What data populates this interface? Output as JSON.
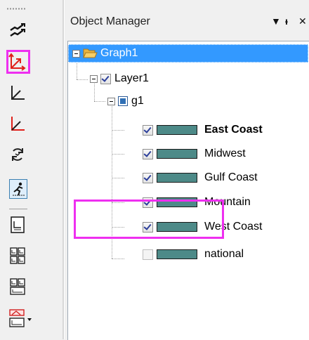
{
  "panel": {
    "title": "Object Manager",
    "dropdown_glyph": "▼",
    "pin_glyph": "ᵻ",
    "close_glyph": "✕"
  },
  "tree": {
    "graph": {
      "label": "Graph1",
      "expanded": true,
      "selected": true
    },
    "layer": {
      "label": "Layer1",
      "checked": true,
      "expanded": true
    },
    "group": {
      "label": "g1",
      "expanded": true
    },
    "plots": [
      {
        "label": "East Coast",
        "checked": true,
        "bold": true,
        "color": "#4d8a88"
      },
      {
        "label": "Midwest",
        "checked": true,
        "bold": false,
        "color": "#4d8a88"
      },
      {
        "label": "Gulf Coast",
        "checked": true,
        "bold": false,
        "color": "#4d8a88"
      },
      {
        "label": "Mountain",
        "checked": true,
        "bold": false,
        "color": "#4d8a88"
      },
      {
        "label": "West Coast",
        "checked": true,
        "bold": false,
        "color": "#4d8a88"
      },
      {
        "label": "national",
        "checked": false,
        "bold": false,
        "color": "#4d8a88"
      }
    ]
  },
  "toolbar": {
    "buttons": [
      {
        "icon": "stack-arrows-icon"
      },
      {
        "icon": "add-axis-xy-red-icon",
        "highlighted": true
      },
      {
        "icon": "axis-l-icon"
      },
      {
        "icon": "axis-l-red-icon"
      },
      {
        "icon": "rescale-cycle-icon"
      },
      {
        "icon": "speed-mode-icon",
        "pressed": true
      },
      {
        "icon": "layer-single-icon"
      },
      {
        "icon": "layer-grid-2x2-icon"
      },
      {
        "icon": "layer-grid-2x2-alt-icon"
      },
      {
        "icon": "merge-graph-dropdown-icon"
      }
    ]
  },
  "colors": {
    "selection": "#3399ff",
    "highlight_box": "#ee2ff0",
    "swatch": "#4d8a88"
  }
}
